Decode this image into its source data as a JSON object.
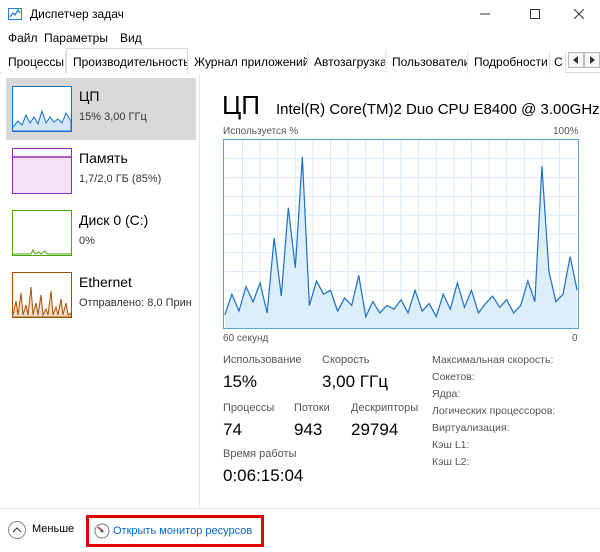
{
  "window": {
    "title": "Диспетчер задач"
  },
  "menu": [
    "Файл",
    "Параметры",
    "Вид"
  ],
  "tabs": [
    "Процессы",
    "Производительность",
    "Журнал приложений",
    "Автозагрузка",
    "Пользователи",
    "Подробности",
    "С"
  ],
  "active_tab": "Производительность",
  "resources": [
    {
      "name": "ЦП",
      "sub": "15% 3,00 ГГц",
      "color": "#1a6fc7",
      "selected": true
    },
    {
      "name": "Память",
      "sub": "1,7/2,0 ГБ (85%)",
      "color": "#9528b4",
      "selected": false
    },
    {
      "name": "Диск 0 (C:)",
      "sub": "0%",
      "color": "#4da60c",
      "selected": false
    },
    {
      "name": "Ethernet",
      "sub": "Отправлено: 8,0 Прин",
      "color": "#a74f01",
      "selected": false
    }
  ],
  "cpu": {
    "title": "ЦП",
    "model": "Intel(R) Core(TM)2 Duo CPU E8400 @ 3.00GHz",
    "graph_label_left": "Используется %",
    "graph_label_right": "100%",
    "graph_time": "60 секунд",
    "graph_zero": "0",
    "usage_series": [
      7,
      18,
      9,
      22,
      14,
      24,
      8,
      48,
      17,
      64,
      32,
      91,
      12,
      25,
      18,
      20,
      9,
      16,
      12,
      28,
      6,
      14,
      8,
      12,
      10,
      15,
      8,
      20,
      9,
      13,
      6,
      18,
      10,
      24,
      11,
      20,
      8,
      13,
      17,
      11,
      15,
      8,
      12,
      25,
      14,
      86,
      30,
      14,
      18,
      38,
      20
    ]
  },
  "stats": {
    "usage_label": "Использование",
    "usage_value": "15%",
    "speed_label": "Скорость",
    "speed_value": "3,00 ГГц",
    "processes_label": "Процессы",
    "processes_value": "74",
    "threads_label": "Потоки",
    "threads_value": "943",
    "handles_label": "Дескрипторы",
    "handles_value": "29794",
    "uptime_label": "Время работы",
    "uptime_value": "0:06:15:04"
  },
  "specs": [
    "Максимальная скорость:",
    "Сокетов:",
    "Ядра:",
    "Логических процессоров:",
    "Виртуализация:",
    "Кэш L1:",
    "Кэш L2:"
  ],
  "footer": {
    "less_label": "Меньше",
    "resmon_label": "Открыть монитор ресурсов"
  },
  "colors": {
    "cpu_accent": "#1a6fc7",
    "highlight_box": "#e00000",
    "link": "#0066cc"
  }
}
